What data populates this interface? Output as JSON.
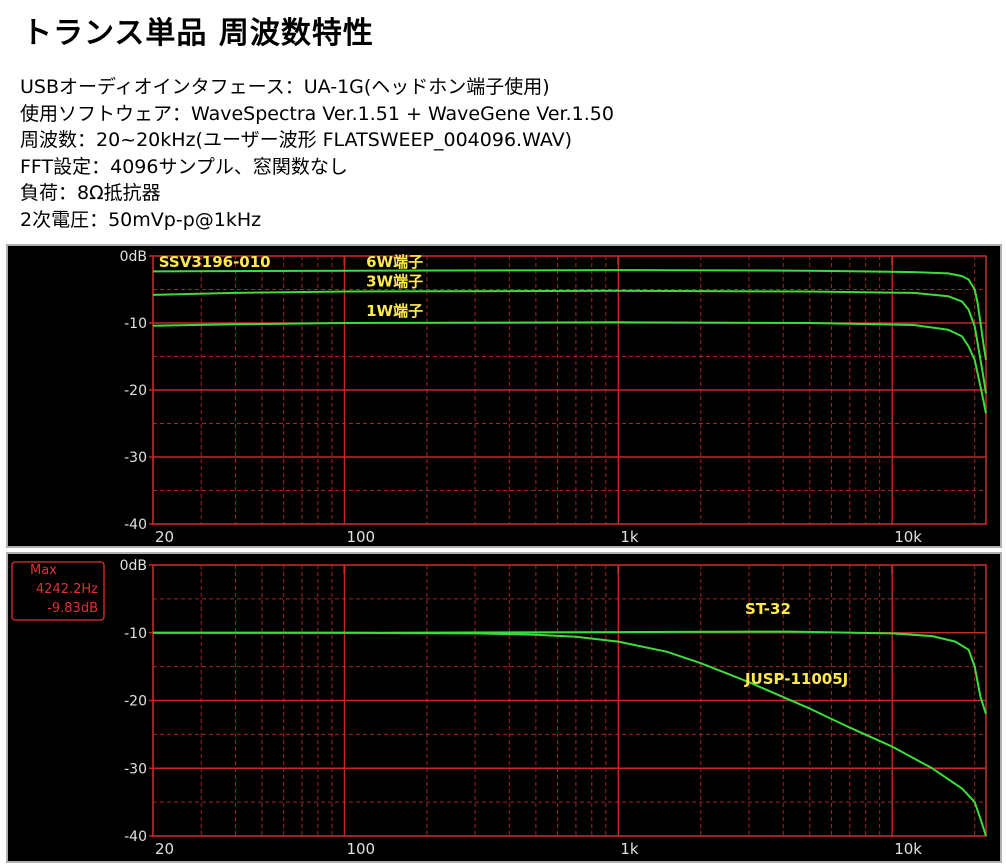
{
  "title": "トランス単品 周波数特性",
  "specs": [
    "USBオーディオインタフェース：UA-1G(ヘッドホン端子使用)",
    "使用ソフトウェア：WaveSpectra Ver.1.51 + WaveGene Ver.1.50",
    "周波数：20~20kHz(ユーザー波形 FLATSWEEP_004096.WAV)",
    "FFT設定：4096サンプル、窓関数なし",
    "負荷：8Ω抵抗器",
    "2次電圧：50mVp-p@1kHz"
  ],
  "colors": {
    "trace": "#3ddc3d",
    "grid": "#c62828",
    "label": "#ffe94d",
    "axis_text": "#e0e0e0",
    "marker_box": "#e03030"
  },
  "chart_data": [
    {
      "type": "line",
      "x_scale": "log",
      "xlim": [
        20,
        22000
      ],
      "ylim": [
        -40,
        0
      ],
      "y_ticks": [
        0,
        -10,
        -20,
        -30,
        -40
      ],
      "y_tick_labels": [
        "0dB",
        "-10",
        "-20",
        "-30",
        "-40"
      ],
      "x_tick_values": [
        20,
        100,
        1000,
        10000
      ],
      "x_tick_labels": [
        "20",
        "100",
        "1k",
        "10k"
      ],
      "grid": true,
      "annotations": [
        {
          "text": "SSV3196-010",
          "freq": 21,
          "db": -0.9
        },
        {
          "text": "6W端子",
          "freq": 120,
          "db": -0.9
        },
        {
          "text": "3W端子",
          "freq": 120,
          "db": -3.8
        },
        {
          "text": "1W端子",
          "freq": 120,
          "db": -8.2
        }
      ],
      "series": [
        {
          "freq": [
            20,
            100,
            1000,
            5000,
            12000,
            16000,
            18000,
            19000,
            20000,
            20500,
            21000,
            21500,
            22000
          ],
          "db": [
            -2.3,
            -2.2,
            -2.1,
            -2.2,
            -2.4,
            -2.6,
            -3.0,
            -3.5,
            -5.0,
            -7.0,
            -10.0,
            -13.0,
            -15.5
          ]
        },
        {
          "freq": [
            20,
            40,
            100,
            1000,
            5000,
            12000,
            16000,
            18000,
            19000,
            20000,
            20500,
            21000,
            21500,
            22000
          ],
          "db": [
            -5.8,
            -5.5,
            -5.3,
            -5.2,
            -5.3,
            -5.5,
            -6.0,
            -6.8,
            -8.0,
            -10.5,
            -13.0,
            -15.5,
            -18.0,
            -20.5
          ]
        },
        {
          "freq": [
            20,
            40,
            100,
            1000,
            5000,
            12000,
            16000,
            18000,
            19000,
            20000,
            20500,
            21000,
            21500,
            22000
          ],
          "db": [
            -10.4,
            -10.2,
            -10.0,
            -9.9,
            -10.0,
            -10.3,
            -11.0,
            -12.0,
            -13.5,
            -15.5,
            -17.5,
            -19.5,
            -21.5,
            -23.5
          ]
        }
      ]
    },
    {
      "type": "line",
      "x_scale": "log",
      "xlim": [
        20,
        22000
      ],
      "ylim": [
        -40,
        0
      ],
      "y_ticks": [
        0,
        -10,
        -20,
        -30,
        -40
      ],
      "y_tick_labels": [
        "0dB",
        "-10",
        "-20",
        "-30",
        "-40"
      ],
      "x_tick_values": [
        20,
        100,
        1000,
        10000
      ],
      "x_tick_labels": [
        "20",
        "100",
        "1k",
        "10k"
      ],
      "grid": true,
      "marker": {
        "label": "Max",
        "freq": "4242.2Hz",
        "level": "-9.83dB"
      },
      "annotations": [
        {
          "text": "ST-32",
          "freq": 2900,
          "db": -6.5
        },
        {
          "text": "JUSP-11005J",
          "freq": 2900,
          "db": -16.8
        }
      ],
      "series": [
        {
          "freq": [
            20,
            100,
            1000,
            4242,
            10000,
            14000,
            17000,
            19000,
            20000,
            21000,
            22000
          ],
          "db": [
            -10.0,
            -10.0,
            -9.9,
            -9.83,
            -10.1,
            -10.5,
            -11.3,
            -12.5,
            -15.0,
            -19.5,
            -22.0
          ]
        },
        {
          "freq": [
            20,
            100,
            300,
            500,
            700,
            1000,
            1500,
            2000,
            3000,
            4000,
            5000,
            7000,
            10000,
            14000,
            18000,
            20000,
            21000,
            22000
          ],
          "db": [
            -10.0,
            -10.0,
            -10.1,
            -10.3,
            -10.6,
            -11.3,
            -12.8,
            -14.5,
            -17.3,
            -19.5,
            -21.2,
            -24.0,
            -26.8,
            -30.0,
            -33.0,
            -35.0,
            -37.5,
            -40.0
          ]
        }
      ]
    }
  ]
}
